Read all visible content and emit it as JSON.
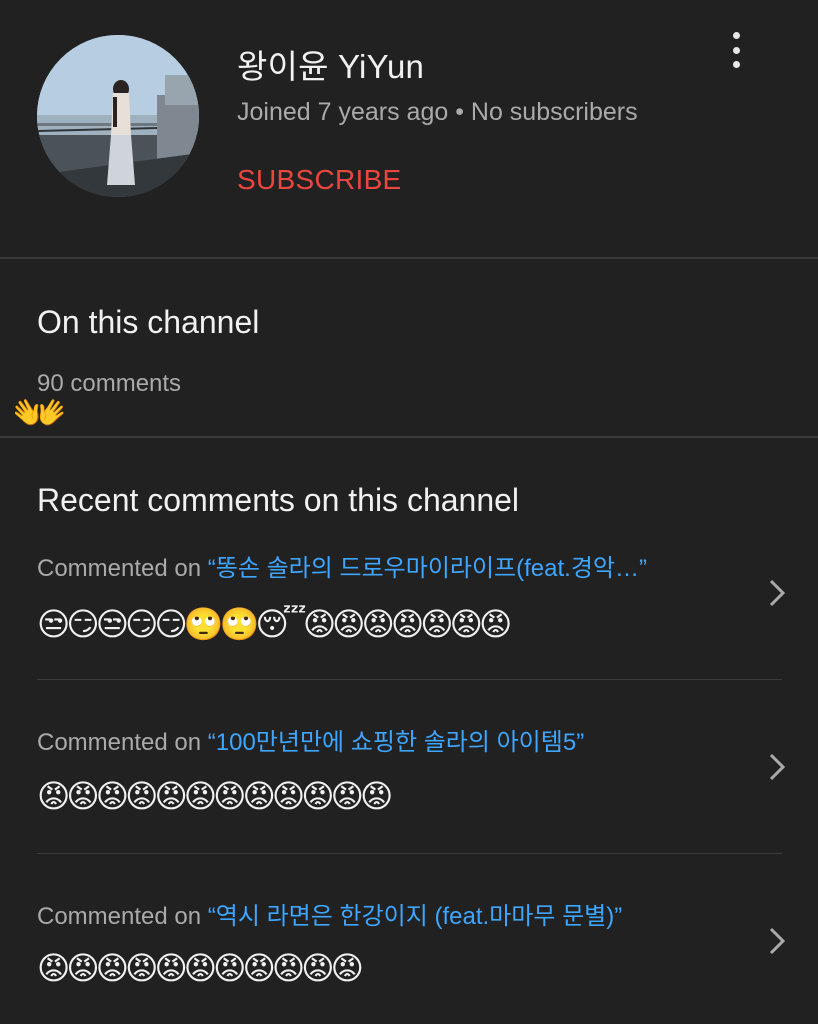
{
  "channel": {
    "name": "왕이윤 YiYun",
    "meta": "Joined 7 years ago • No subscribers",
    "subscribe_label": "SUBSCRIBE"
  },
  "on_channel": {
    "title": "On this channel",
    "count": "90 comments",
    "overlay_emoji": "👐"
  },
  "recent": {
    "title": "Recent comments on this channel",
    "comments": [
      {
        "prefix": "Commented on ",
        "video": "“똥손 솔라의 드로우마이라이프(feat.경악…”",
        "emojis": "😒😏😒😏😏🙄🙄😴😡😡😡😡😡😡😡"
      },
      {
        "prefix": "Commented on ",
        "video": "“100만년만에 쇼핑한 솔라의 아이템5”",
        "emojis": "😡😡😡😡😡😡😡😡😡😡😡😡"
      },
      {
        "prefix": "Commented on ",
        "video": "“역시 라면은 한강이지 (feat.마마무 문별)”",
        "emojis": "😡😡😡😡😡😡😡😡😡😡😡"
      }
    ]
  },
  "colors": {
    "background": "#212121",
    "accent_red": "#e9463f",
    "link_blue": "#3ea6ff",
    "secondary_text": "#aaaaaa"
  },
  "icons": {
    "more": "more-vertical-icon",
    "chevron": "chevron-right-icon"
  }
}
